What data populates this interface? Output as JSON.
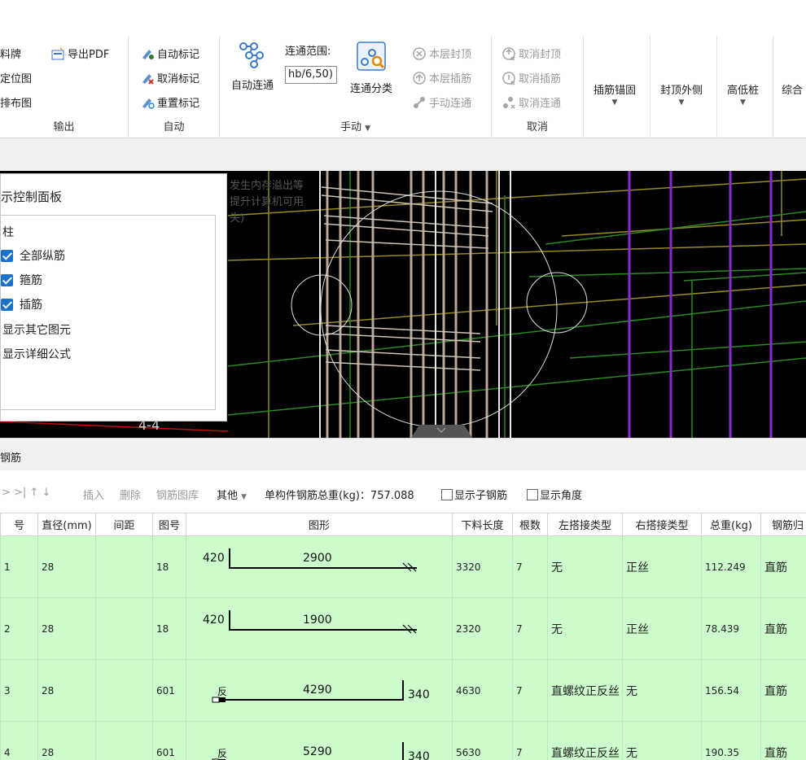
{
  "ribbon": {
    "output": {
      "title": "输出",
      "items": [
        "料牌",
        "定位图",
        "排布图"
      ],
      "export_pdf": "导出PDF"
    },
    "auto": {
      "title": "自动",
      "items": [
        "自动标记",
        "取消标记",
        "重置标记"
      ]
    },
    "manual": {
      "title": "手动",
      "auto_connect": "自动连通",
      "range_label": "连通范围:",
      "range_value": "hb/6,50)",
      "classify": "连通分类",
      "items": [
        "本层封顶",
        "本层插筋",
        "手动连通"
      ]
    },
    "cancel": {
      "title": "取消",
      "items": [
        "取消封顶",
        "取消插筋",
        "取消连通"
      ]
    },
    "extra": [
      "插筋锚固",
      "封顶外侧",
      "高低桩",
      "综合"
    ]
  },
  "viewport": {
    "bg_text": [
      "发生内存溢出等",
      "提升计算机可用",
      "失)"
    ],
    "section_label": "4-4"
  },
  "panel": {
    "title": "示控制面板",
    "group": "柱",
    "options": [
      {
        "label": "全部纵筋",
        "checked": true
      },
      {
        "label": "箍筋",
        "checked": true
      },
      {
        "label": "插筋",
        "checked": true
      },
      {
        "label": "显示其它图元",
        "checked": false
      },
      {
        "label": "显示详细公式",
        "checked": false
      }
    ]
  },
  "section": {
    "title": "钢筋"
  },
  "toolbar": {
    "nav": ">   >|  ↑  ↓",
    "insert": "插入",
    "delete": "删除",
    "library": "钢筋图库",
    "other": "其他",
    "total_label": "单构件钢筋总重(kg)：757.088",
    "show_sub": "显示子钢筋",
    "show_angle": "显示角度"
  },
  "table": {
    "headers": [
      "号",
      "直径(mm)",
      "间距",
      "图号",
      "图形",
      "下料长度",
      "根数",
      "左搭接类型",
      "右搭接类型",
      "总重(kg)",
      "钢筋归"
    ],
    "rows": [
      {
        "no": "1",
        "dia": "28",
        "spacing": "",
        "fig": "18",
        "left": "420",
        "mid": "2900",
        "right": "",
        "len": "3320",
        "count": "7",
        "ltype": "无",
        "rtype": "正丝",
        "weight": "112.249",
        "kind": "直筋",
        "shape": "hook"
      },
      {
        "no": "2",
        "dia": "28",
        "spacing": "",
        "fig": "18",
        "left": "420",
        "mid": "1900",
        "right": "",
        "len": "2320",
        "count": "7",
        "ltype": "无",
        "rtype": "正丝",
        "weight": "78.439",
        "kind": "直筋",
        "shape": "hook"
      },
      {
        "no": "3",
        "dia": "28",
        "spacing": "",
        "fig": "601",
        "left": "",
        "mid": "4290",
        "right": "340",
        "len": "4630",
        "count": "7",
        "ltype": "直螺纹正反丝",
        "rtype": "无",
        "weight": "156.54",
        "kind": "直筋",
        "shape": "reverse",
        "mark": "反"
      },
      {
        "no": "4",
        "dia": "28",
        "spacing": "",
        "fig": "601",
        "left": "",
        "mid": "5290",
        "right": "340",
        "len": "5630",
        "count": "7",
        "ltype": "直螺纹正反丝",
        "rtype": "无",
        "weight": "190.35",
        "kind": "直筋",
        "shape": "reverse",
        "mark": "反"
      }
    ]
  },
  "colors": {
    "row_bg": "#ccfccc",
    "accent": "#1a73c9",
    "viewport_bg": "#000000"
  }
}
